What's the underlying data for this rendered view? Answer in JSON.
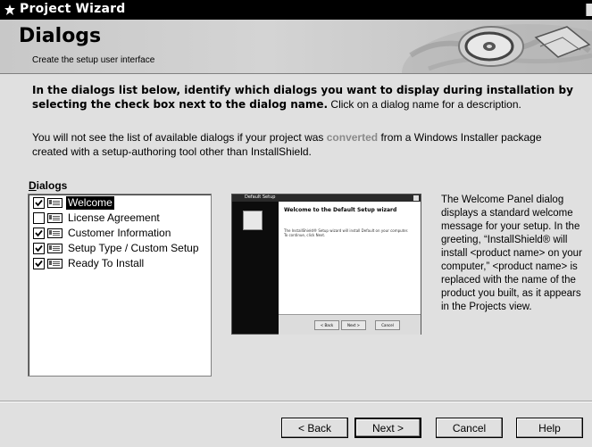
{
  "window": {
    "title": "Project Wizard",
    "icon": "wizard-app-icon",
    "close_icon": "close-icon"
  },
  "header": {
    "title": "Dialogs",
    "subtitle": "Create the setup user interface",
    "art": "globe-and-disc-banner"
  },
  "intro": {
    "bold_text": "In the dialogs list below, identify which dialogs you want to display during installation by selecting the check box next to the dialog name.",
    "normal_text": " Click on a dialog name for a description."
  },
  "note": {
    "part1": "You will not see the list of available dialogs if your project was ",
    "highlight": "converted",
    "part2": " from a Windows Installer package created with a setup-authoring tool other than InstallShield."
  },
  "dialogs": {
    "label_prefix": "D",
    "label_rest": "ialogs",
    "items": [
      {
        "label": "Welcome",
        "checked": true,
        "selected": true,
        "icon": "dialog-icon"
      },
      {
        "label": "License Agreement",
        "checked": false,
        "selected": false,
        "icon": "dialog-icon"
      },
      {
        "label": "Customer Information",
        "checked": true,
        "selected": false,
        "icon": "dialog-icon"
      },
      {
        "label": "Setup Type / Custom Setup",
        "checked": true,
        "selected": false,
        "icon": "dialog-icon"
      },
      {
        "label": "Ready To Install",
        "checked": true,
        "selected": false,
        "icon": "dialog-icon"
      }
    ]
  },
  "preview": {
    "title": "Default Setup",
    "heading": "Welcome to the Default Setup wizard",
    "body": "The InstallShield® Setup wizard will install Default on your computer. To continue, click Next.",
    "back": "< Back",
    "next": "Next >",
    "cancel": "Cancel"
  },
  "description": "The Welcome Panel dialog displays a standard welcome message for your setup.  In the greeting, “InstallShield® will install <product name> on your computer,” <product name> is replaced with the name of the product you built, as it appears in the Projects view.",
  "buttons": {
    "back": "< Back",
    "next": "Next >",
    "cancel": "Cancel",
    "help": "Help"
  }
}
